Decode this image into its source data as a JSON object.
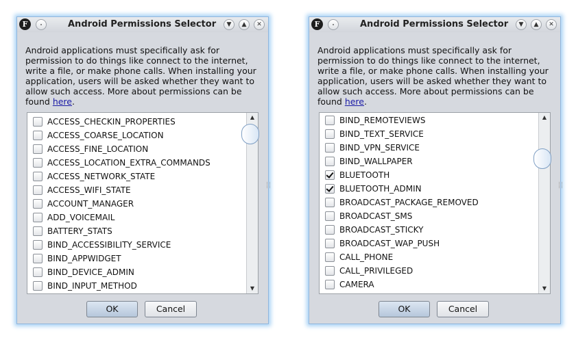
{
  "dialogs": [
    {
      "title": "Android Permissions Selector",
      "app_icon": "F",
      "description": "Android applications must specifically ask for permission to do things like connect to the internet, write a file, or make phone calls. When installing your application, users will be asked whether they want to allow such access. More about permissions can be found",
      "link_text": "here",
      "link_suffix": ".",
      "items": [
        {
          "label": "ACCESS_CHECKIN_PROPERTIES",
          "checked": false
        },
        {
          "label": "ACCESS_COARSE_LOCATION",
          "checked": false
        },
        {
          "label": "ACCESS_FINE_LOCATION",
          "checked": false
        },
        {
          "label": "ACCESS_LOCATION_EXTRA_COMMANDS",
          "checked": false
        },
        {
          "label": "ACCESS_NETWORK_STATE",
          "checked": false
        },
        {
          "label": "ACCESS_WIFI_STATE",
          "checked": false
        },
        {
          "label": "ACCOUNT_MANAGER",
          "checked": false
        },
        {
          "label": "ADD_VOICEMAIL",
          "checked": false
        },
        {
          "label": "BATTERY_STATS",
          "checked": false
        },
        {
          "label": "BIND_ACCESSIBILITY_SERVICE",
          "checked": false
        },
        {
          "label": "BIND_APPWIDGET",
          "checked": false
        },
        {
          "label": "BIND_DEVICE_ADMIN",
          "checked": false
        },
        {
          "label": "BIND_INPUT_METHOD",
          "checked": false
        }
      ],
      "ok_label": "OK",
      "cancel_label": "Cancel"
    },
    {
      "title": "Android Permissions Selector",
      "app_icon": "F",
      "description": "Android applications must specifically ask for permission to do things like connect to the internet, write a file, or make phone calls. When installing your application, users will be asked whether they want to allow such access. More about permissions can be found",
      "link_text": "here",
      "link_suffix": ".",
      "items": [
        {
          "label": "BIND_REMOTEVIEWS",
          "checked": false
        },
        {
          "label": "BIND_TEXT_SERVICE",
          "checked": false
        },
        {
          "label": "BIND_VPN_SERVICE",
          "checked": false
        },
        {
          "label": "BIND_WALLPAPER",
          "checked": false
        },
        {
          "label": "BLUETOOTH",
          "checked": true
        },
        {
          "label": "BLUETOOTH_ADMIN",
          "checked": true
        },
        {
          "label": "BROADCAST_PACKAGE_REMOVED",
          "checked": false
        },
        {
          "label": "BROADCAST_SMS",
          "checked": false
        },
        {
          "label": "BROADCAST_STICKY",
          "checked": false
        },
        {
          "label": "BROADCAST_WAP_PUSH",
          "checked": false
        },
        {
          "label": "CALL_PHONE",
          "checked": false
        },
        {
          "label": "CALL_PRIVILEGED",
          "checked": false
        },
        {
          "label": "CAMERA",
          "checked": false
        }
      ],
      "ok_label": "OK",
      "cancel_label": "Cancel"
    }
  ]
}
